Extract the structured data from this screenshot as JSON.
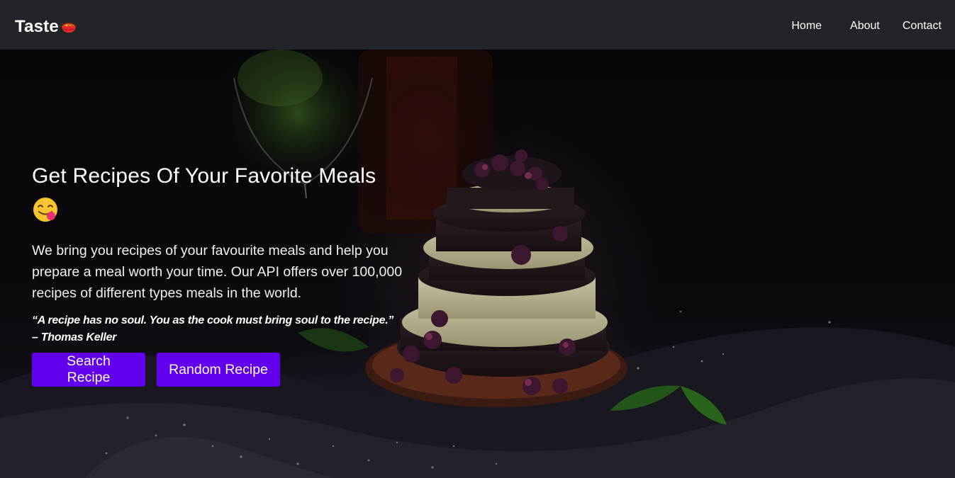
{
  "brand": {
    "name": "Taste",
    "icon": "food-bowl-icon"
  },
  "nav": {
    "home": "Home",
    "about": "About",
    "contact": "Contact"
  },
  "hero": {
    "title": "Get Recipes Of Your Favorite Meals",
    "title_emoji": "yum-face-icon",
    "description": "We bring you recipes of your favourite meals and help you prepare a meal worth your time. Our API offers over 100,000 recipes of different types meals in the world.",
    "quote": "“A recipe has no soul. You as the cook must bring soul to the recipe.” – Thomas Keller",
    "search_button": "Search Recipe",
    "random_button": "Random Recipe",
    "background_image": "layered-berry-cake-photo"
  },
  "colors": {
    "navbar": "#212529",
    "button": "#6200ee",
    "text": "#ffffff"
  }
}
